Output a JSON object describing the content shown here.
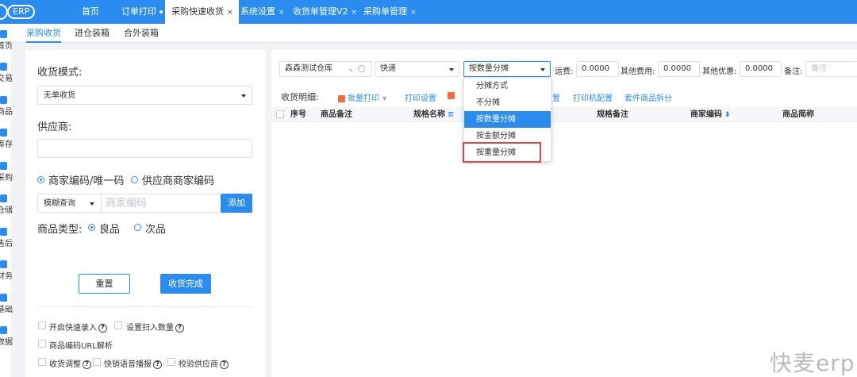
{
  "app": {
    "logo_text": "ERP"
  },
  "tabs": [
    {
      "label": "首页",
      "closable": false
    },
    {
      "label": "订单打印",
      "closable": false
    },
    {
      "label": "采购快速收货",
      "closable": true,
      "active": true
    },
    {
      "label": "系统设置",
      "closable": true
    },
    {
      "label": "收货单管理V2",
      "closable": true
    },
    {
      "label": "采购单管理",
      "closable": true
    }
  ],
  "close_glyph": "×",
  "sidenav": [
    {
      "label": "首页",
      "icon": "home-icon"
    },
    {
      "label": "交易",
      "icon": "trade-icon"
    },
    {
      "label": "商品",
      "icon": "goods-icon"
    },
    {
      "label": "库存",
      "icon": "stock-icon"
    },
    {
      "label": "采购",
      "icon": "purchase-icon"
    },
    {
      "label": "仓储",
      "icon": "warehouse-icon"
    },
    {
      "label": "售后",
      "icon": "aftersale-icon"
    },
    {
      "label": "财务",
      "icon": "finance-icon"
    },
    {
      "label": "基础",
      "icon": "basic-icon"
    },
    {
      "label": "数据",
      "icon": "data-icon"
    }
  ],
  "subtabs": [
    "采购收货",
    "进仓装箱",
    "合外装箱"
  ],
  "left": {
    "mode_label": "收货模式:",
    "mode_value": "无单收货",
    "supplier_label": "供应商:",
    "supplier_value": "",
    "code_option1": "商家编码/唯一码",
    "code_option2": "供应商商家编码",
    "query_mode": "模糊查询",
    "code_placeholder": "商家编码",
    "add_button": "添加",
    "goods_type_label": "商品类型:",
    "goods_type_good": "良品",
    "goods_type_bad": "次品",
    "reset_button": "重置",
    "finish_button": "收货完成",
    "options": {
      "quick_entry": "开启快速录入",
      "scan_qty": "设置扫入数量",
      "url_parse": "商品编码URL解析",
      "adjust": "收货调整",
      "voice": "快销语音播报",
      "verify_supplier": "校验供应商"
    },
    "help_glyph": "?"
  },
  "right": {
    "warehouse": "森森测试仓库",
    "delivery": "快递",
    "allocation": "按数量分摊",
    "freight_label": "运费:",
    "freight_value": "0.0000",
    "other_fee_label": "其他费用:",
    "other_fee_value": "0.0000",
    "discount_label": "其他优惠:",
    "discount_value": "0.0000",
    "remark_label": "备注:",
    "remark_placeholder": "备注",
    "detail_label": "收货明细:",
    "toolbar": {
      "batch_print": "批量打印",
      "print_settings": "打印设置",
      "layout_settings": "置",
      "printer_config": "打印机配置",
      "kit_split": "套件商品拆分"
    },
    "columns": [
      "序号",
      "商品备注",
      "规格名称",
      "规格备注",
      "商家编码",
      "商品简称"
    ],
    "dropdown_options": [
      "分摊方式",
      "不分摊",
      "按数量分摊",
      "按金额分摊",
      "按重量分摊"
    ],
    "dropdown_selected_index": 2,
    "dropdown_highlighted_index": 4
  },
  "watermark": "快麦erp",
  "colors": {
    "brand": "#2b8cf0",
    "highlight": "#e64545"
  }
}
